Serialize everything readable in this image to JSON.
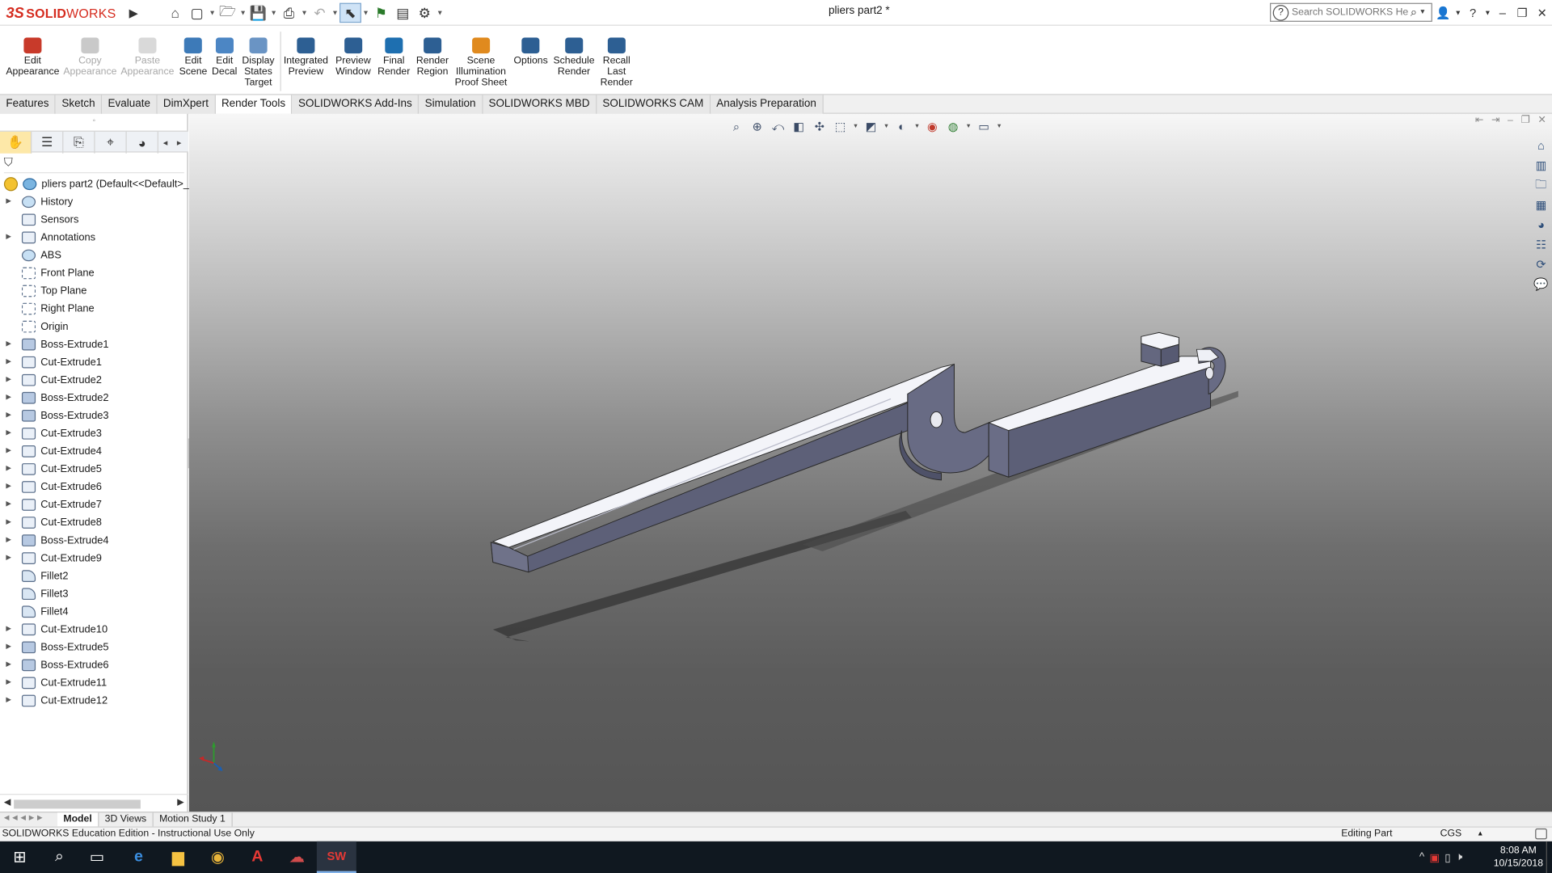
{
  "titlebar": {
    "brand_prefix": "3S",
    "brand_name": "SOLID",
    "brand_name2": "WORKS",
    "doc_title": "pliers part2 *",
    "search_placeholder": "Search SOLIDWORKS Help",
    "controls": [
      "?",
      "–",
      "❐",
      "✕"
    ]
  },
  "command_manager": {
    "items": [
      {
        "label_lines": [
          "Edit",
          "Appearance"
        ],
        "enabled": true,
        "icon": "edit-appearance-icon",
        "color": "#c83a2a"
      },
      {
        "label_lines": [
          "Copy",
          "Appearance"
        ],
        "enabled": false,
        "icon": "copy-appearance-icon",
        "color": "#c9c9c9"
      },
      {
        "label_lines": [
          "Paste",
          "Appearance"
        ],
        "enabled": false,
        "icon": "paste-appearance-icon",
        "color": "#d9d9d9"
      },
      {
        "label_lines": [
          "Edit",
          "Scene"
        ],
        "enabled": true,
        "icon": "edit-scene-icon",
        "color": "#3d7ab8"
      },
      {
        "label_lines": [
          "Edit",
          "Decal"
        ],
        "enabled": true,
        "icon": "edit-decal-icon",
        "color": "#4c86c4"
      },
      {
        "label_lines": [
          "Display",
          "States",
          "Target"
        ],
        "enabled": true,
        "icon": "display-states-target-icon",
        "color": "#6a94c4"
      },
      {
        "label_lines": [
          "Integrated",
          "Preview"
        ],
        "enabled": true,
        "icon": "integrated-preview-icon",
        "color": "#2d5f93"
      },
      {
        "label_lines": [
          "Preview",
          "Window"
        ],
        "enabled": true,
        "icon": "preview-window-icon",
        "color": "#2d5f93"
      },
      {
        "label_lines": [
          "Final",
          "Render"
        ],
        "enabled": true,
        "icon": "final-render-icon",
        "color": "#1e6fb0"
      },
      {
        "label_lines": [
          "Render",
          "Region"
        ],
        "enabled": true,
        "icon": "render-region-icon",
        "color": "#2d5f93"
      },
      {
        "label_lines": [
          "Scene",
          "Illumination",
          "Proof Sheet"
        ],
        "enabled": true,
        "icon": "scene-illumination-icon",
        "color": "#e08a1e"
      },
      {
        "label_lines": [
          "Options"
        ],
        "enabled": true,
        "icon": "options-icon",
        "color": "#2d5f93"
      },
      {
        "label_lines": [
          "Schedule",
          "Render"
        ],
        "enabled": true,
        "icon": "schedule-render-icon",
        "color": "#2d5f93"
      },
      {
        "label_lines": [
          "Recall",
          "Last",
          "Render"
        ],
        "enabled": true,
        "icon": "recall-last-render-icon",
        "color": "#2d5f93"
      }
    ]
  },
  "tabs": [
    {
      "label": "Features",
      "active": false
    },
    {
      "label": "Sketch",
      "active": false
    },
    {
      "label": "Evaluate",
      "active": false
    },
    {
      "label": "DimXpert",
      "active": false
    },
    {
      "label": "Render Tools",
      "active": true
    },
    {
      "label": "SOLIDWORKS Add-Ins",
      "active": false
    },
    {
      "label": "Simulation",
      "active": false
    },
    {
      "label": "SOLIDWORKS MBD",
      "active": false
    },
    {
      "label": "SOLIDWORKS CAM",
      "active": false
    },
    {
      "label": "Analysis Preparation",
      "active": false
    }
  ],
  "feature_tree": {
    "root": "pliers part2  (Default<<Default>_D",
    "items": [
      {
        "label": "History",
        "expandable": true,
        "kind": "history"
      },
      {
        "label": "Sensors",
        "expandable": false,
        "kind": "sensor"
      },
      {
        "label": "Annotations",
        "expandable": true,
        "kind": "annotation"
      },
      {
        "label": "ABS",
        "expandable": false,
        "kind": "material"
      },
      {
        "label": "Front Plane",
        "expandable": false,
        "kind": "plane"
      },
      {
        "label": "Top Plane",
        "expandable": false,
        "kind": "plane"
      },
      {
        "label": "Right Plane",
        "expandable": false,
        "kind": "plane"
      },
      {
        "label": "Origin",
        "expandable": false,
        "kind": "origin"
      },
      {
        "label": "Boss-Extrude1",
        "expandable": true,
        "kind": "boss"
      },
      {
        "label": "Cut-Extrude1",
        "expandable": true,
        "kind": "cut"
      },
      {
        "label": "Cut-Extrude2",
        "expandable": true,
        "kind": "cut"
      },
      {
        "label": "Boss-Extrude2",
        "expandable": true,
        "kind": "boss"
      },
      {
        "label": "Boss-Extrude3",
        "expandable": true,
        "kind": "boss"
      },
      {
        "label": "Cut-Extrude3",
        "expandable": true,
        "kind": "cut"
      },
      {
        "label": "Cut-Extrude4",
        "expandable": true,
        "kind": "cut"
      },
      {
        "label": "Cut-Extrude5",
        "expandable": true,
        "kind": "cut"
      },
      {
        "label": "Cut-Extrude6",
        "expandable": true,
        "kind": "cut"
      },
      {
        "label": "Cut-Extrude7",
        "expandable": true,
        "kind": "cut"
      },
      {
        "label": "Cut-Extrude8",
        "expandable": true,
        "kind": "cut"
      },
      {
        "label": "Boss-Extrude4",
        "expandable": true,
        "kind": "boss"
      },
      {
        "label": "Cut-Extrude9",
        "expandable": true,
        "kind": "cut"
      },
      {
        "label": "Fillet2",
        "expandable": false,
        "kind": "fillet"
      },
      {
        "label": "Fillet3",
        "expandable": false,
        "kind": "fillet"
      },
      {
        "label": "Fillet4",
        "expandable": false,
        "kind": "fillet"
      },
      {
        "label": "Cut-Extrude10",
        "expandable": true,
        "kind": "cut"
      },
      {
        "label": "Boss-Extrude5",
        "expandable": true,
        "kind": "boss"
      },
      {
        "label": "Boss-Extrude6",
        "expandable": true,
        "kind": "boss"
      },
      {
        "label": "Cut-Extrude11",
        "expandable": true,
        "kind": "cut"
      },
      {
        "label": "Cut-Extrude12",
        "expandable": true,
        "kind": "cut"
      }
    ]
  },
  "bottom_tabs": [
    {
      "label": "Model",
      "active": true
    },
    {
      "label": "3D Views",
      "active": false
    },
    {
      "label": "Motion Study 1",
      "active": false
    }
  ],
  "status": {
    "left": "SOLIDWORKS Education Edition - Instructional Use Only",
    "mode": "Editing Part",
    "units": "CGS"
  },
  "taskbar": {
    "time": "8:08 AM",
    "date": "10/15/2018",
    "apps": [
      "start-icon",
      "search-icon",
      "task-view-icon",
      "edge-icon",
      "file-explorer-icon",
      "chrome-icon",
      "acrobat-icon",
      "app-icon",
      "solidworks-icon"
    ]
  },
  "colors": {
    "brand": "#d52b1e",
    "active_tab_bg": "#ffffff",
    "rollback_bar": "#2d7ec4",
    "model_face_top": "#f2f3f8",
    "model_face_side": "#6c6f88",
    "model_face_front": "#545770"
  }
}
